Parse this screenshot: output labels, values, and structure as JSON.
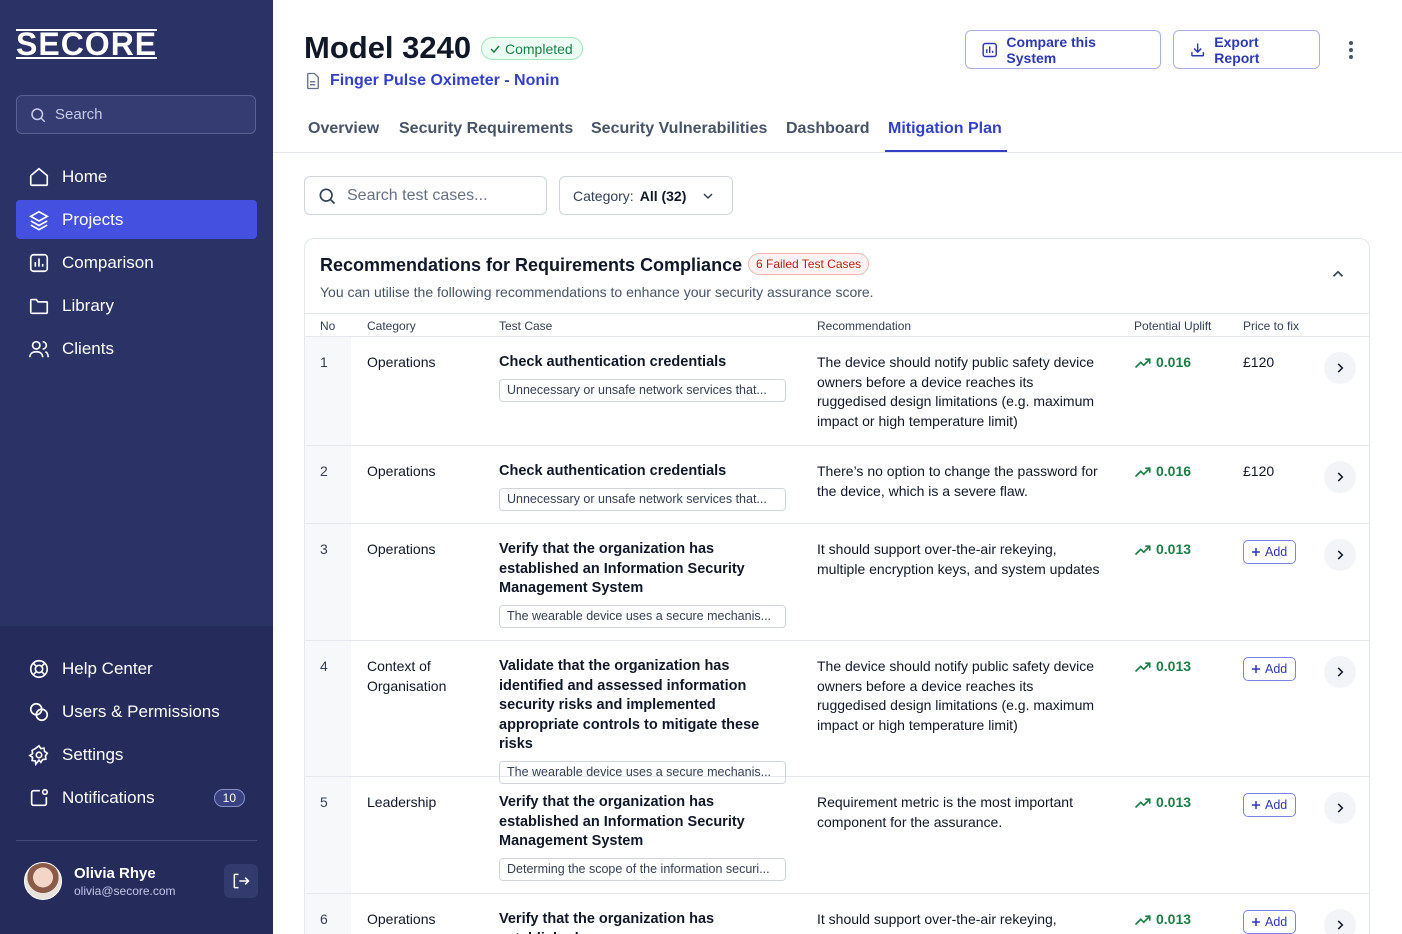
{
  "brand": {
    "logo_text": "SECORE"
  },
  "sidebar": {
    "search_placeholder": "Search",
    "nav": [
      {
        "label": "Home",
        "icon": "home-icon"
      },
      {
        "label": "Projects",
        "icon": "layers-icon",
        "active": true
      },
      {
        "label": "Comparison",
        "icon": "bar-chart-icon"
      },
      {
        "label": "Library",
        "icon": "folder-icon"
      },
      {
        "label": "Clients",
        "icon": "users-icon"
      }
    ],
    "lower_nav": [
      {
        "label": "Help Center",
        "icon": "lifebuoy-icon"
      },
      {
        "label": "Users & Permissions",
        "icon": "permissions-icon"
      },
      {
        "label": "Settings",
        "icon": "gear-icon"
      },
      {
        "label": "Notifications",
        "icon": "notification-icon",
        "count": "10"
      }
    ],
    "user": {
      "name": "Olivia Rhye",
      "email": "olivia@secore.com"
    }
  },
  "header": {
    "title": "Model 3240",
    "status": "Completed",
    "subtitle": "Finger Pulse Oximeter - Nonin",
    "compare_label": "Compare this System",
    "export_label": "Export Report"
  },
  "tabs": [
    "Overview",
    "Security Requirements",
    "Security Vulnerabilities",
    "Dashboard",
    "Mitigation Plan"
  ],
  "filters": {
    "search_placeholder": "Search test cases...",
    "category_label": "Category:",
    "category_value": "All (32)"
  },
  "card": {
    "title": "Recommendations for Requirements Compliance",
    "failed_badge": "6 Failed Test Cases",
    "subtitle": "You can utilise the following recommendations to enhance your security assurance score.",
    "columns": [
      "No",
      "Category",
      "Test Case",
      "Recommendation",
      "Potential Uplift",
      "Price to fix"
    ],
    "add_label": "Add",
    "rows": [
      {
        "no": "1",
        "category": "Operations",
        "test_case": "Check authentication credentials",
        "tag": "Unnecessary or unsafe network services that...",
        "recommendation": "The device should notify public safety device owners before a device reaches its ruggedised design limitations (e.g. maximum impact or high temperature limit)",
        "uplift": "0.016",
        "price": "£120"
      },
      {
        "no": "2",
        "category": "Operations",
        "test_case": "Check authentication credentials",
        "tag": "Unnecessary or unsafe network services that...",
        "recommendation": "There’s no option to change the password for the device, which is a severe flaw.",
        "uplift": "0.016",
        "price": "£120"
      },
      {
        "no": "3",
        "category": "Operations",
        "test_case": "Verify that the organization has established an Information Security Management System",
        "tag": "The wearable device uses a secure mechanis...",
        "recommendation": "It should support over-the-air rekeying, multiple encryption keys, and system updates",
        "uplift": "0.013",
        "price": ""
      },
      {
        "no": "4",
        "category": "Context of Organisation",
        "test_case": "Validate that the organization has identified and assessed information security risks and implemented appropriate controls to mitigate these risks",
        "tag": "The wearable device uses a secure mechanis...",
        "recommendation": "The device should notify public safety device owners before a device reaches its ruggedised design limitations (e.g. maximum impact or high temperature limit)",
        "uplift": "0.013",
        "price": ""
      },
      {
        "no": "5",
        "category": "Leadership",
        "test_case": "Verify that the organization has established an Information Security Management System",
        "tag": "Determing the scope of the information securi...",
        "recommendation": "Requirement metric is the most important component for the assurance.",
        "uplift": "0.013",
        "price": ""
      },
      {
        "no": "6",
        "category": "Operations",
        "test_case": "Verify that the organization has established",
        "tag": "",
        "recommendation": "It should support over-the-air rekeying,",
        "uplift": "0.013",
        "price": ""
      }
    ]
  },
  "colors": {
    "sidebar": "#2b3266",
    "accent": "#4450e0",
    "success": "#1a7f47",
    "danger": "#b42318"
  }
}
